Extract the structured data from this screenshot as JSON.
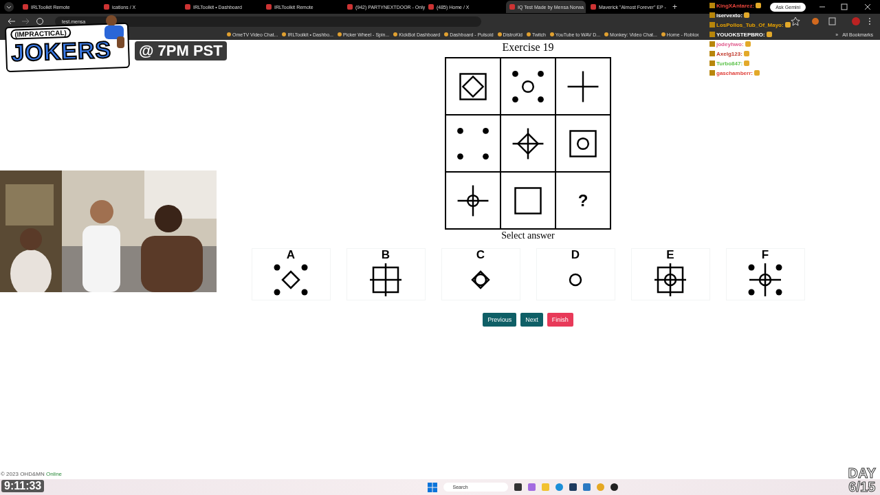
{
  "browser": {
    "tabs": [
      {
        "title": "IRLToolkit Remote",
        "selected": false
      },
      {
        "title": "ications / X",
        "selected": false
      },
      {
        "title": "IRLToolkit • Dashboard",
        "selected": false
      },
      {
        "title": "IRLToolkit Remote",
        "selected": false
      },
      {
        "title": "(942) PARTYNEXTDOOR - Only",
        "selected": false
      },
      {
        "title": "(485) Home / X",
        "selected": false
      },
      {
        "title": "IQ Test Made by Mensa Norwa",
        "selected": true
      },
      {
        "title": "Maverick \"Almost Forever\" EP -",
        "selected": false
      }
    ],
    "new_tab": "+",
    "gemini_button": "Ask Gemini",
    "address": "test.mensa",
    "bookmarks": [
      "OmeTV Video Chat...",
      "IRLToolkit • Dashbo...",
      "Picker Wheel - Spin...",
      "KickBot Dashboard",
      "Dashboard - Pulsoid",
      "DistroKid",
      "Twitch",
      "YouTube to WAV D...",
      "Monkey: Video Chat...",
      "Home - Roblox"
    ],
    "more_bookmarks": "»",
    "all_bookmarks": "All Bookmarks"
  },
  "overlay": {
    "logo_top": "(IMPRACTICAL)",
    "logo_main": "JOKERS",
    "schedule": "@ 7PM PST",
    "clock": "9:11:33",
    "day_label": "DAY",
    "day_count": "6/15"
  },
  "chat": [
    {
      "user": "KingXAntarez:",
      "color": "#e8453c"
    },
    {
      "user": "iservexto:",
      "color": "#ffffff"
    },
    {
      "user": "LosPollos_Tub_Of_Mayo:",
      "color": "#e8a200"
    },
    {
      "user": "YOUOKSTEPBRO:",
      "color": "#ffffff"
    },
    {
      "user": "jodeyhwo:",
      "color": "#e05a8c"
    },
    {
      "user": "Axelg123:",
      "color": "#c0392b"
    },
    {
      "user": "Turbo847:",
      "color": "#5cc24a"
    },
    {
      "user": "gaschamberr:",
      "color": "#e0403a"
    }
  ],
  "exercise": {
    "title": "Exercise 19",
    "cells": [
      {
        "square": true,
        "diamond": true
      },
      {
        "dots": true,
        "circle": true
      },
      {
        "cross": true
      },
      {
        "dots": true
      },
      {
        "cross": true,
        "diamond": true
      },
      {
        "square": true,
        "circle": true
      },
      {
        "cross": true,
        "circle": true
      },
      {
        "square": true
      },
      {
        "text": "?"
      }
    ],
    "prompt": "Select answer",
    "options": [
      {
        "letter": "A",
        "dots": true,
        "diamond": true
      },
      {
        "letter": "B",
        "square": true,
        "cross": true
      },
      {
        "letter": "C",
        "diamond": true,
        "circle": true
      },
      {
        "letter": "D",
        "circle": true
      },
      {
        "letter": "E",
        "square": true,
        "cross": true,
        "circle": true
      },
      {
        "letter": "F",
        "dots": true,
        "cross": true,
        "circle": true
      }
    ],
    "buttons": [
      {
        "label": "Previous",
        "kind": "nav"
      },
      {
        "label": "Next",
        "kind": "nav"
      },
      {
        "label": "Finish",
        "kind": "finish"
      }
    ]
  },
  "footer": {
    "copyright": "© 2023 OHD&MN",
    "link": "Online"
  },
  "taskbar": {
    "search": "Search"
  }
}
